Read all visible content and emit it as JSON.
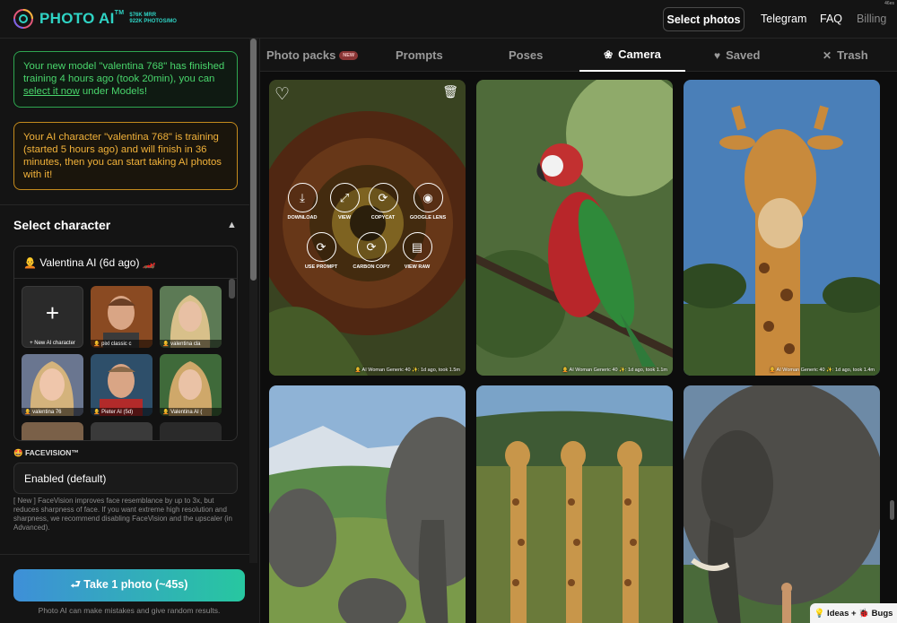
{
  "header": {
    "logo_name": "PHOTO AI",
    "logo_tm": "TM",
    "stats_line1": "$76K MRR",
    "stats_line2": "922K PHOTOS/MO",
    "select_photos": "Select photos",
    "nav": [
      "Telegram",
      "FAQ",
      "Billing"
    ],
    "corner": "46es"
  },
  "sidebar": {
    "notice_ready_pre": "Your new model \"valentina 768\" has finished training 4 hours ago (took 20min), you can ",
    "notice_ready_link": "select it now",
    "notice_ready_post": " under Models!",
    "notice_training": "Your AI character \"valentina 768\" is training (started 5 hours ago) and will finish in 36 minutes, then you can start taking AI photos with it!",
    "select_character": "Select character",
    "character_name": "🧑‍🦲 Valentina AI (6d ago) 🏎️",
    "new_character": "+ New AI character",
    "tiles": [
      {
        "caption": "🧑‍🦲 pixl classic c"
      },
      {
        "caption": "🧑‍🦲 valentina cla"
      },
      {
        "caption": "🧑‍🦲 valentina 76"
      },
      {
        "caption": "🧑‍🦲 Pieter AI (5d)"
      },
      {
        "caption": "🧑‍🦲 Valentina AI ("
      }
    ],
    "facevision_label": "🤩 FACEVISION™",
    "facevision_value": "Enabled (default)",
    "facevision_note": "[ New ] FaceVision improves face resemblance by up to 3x, but reduces sharpness of face. If you want extreme high resolution and sharpness, we recommend disabling FaceVision and the upscaler (in Advanced).",
    "take_photo": "⮐ Take 1 photo (~45s)",
    "disclaimer": "Photo AI can make mistakes and give random results."
  },
  "tabs": {
    "packs": "Photo packs",
    "packs_badge": "NEW",
    "prompts": "Prompts",
    "poses": "Poses",
    "camera": "Camera",
    "saved": "Saved",
    "trash": "Trash"
  },
  "gallery": {
    "actions": [
      "DOWNLOAD",
      "VIEW",
      "COPYCAT",
      "GOOGLE LENS",
      "USE PROMPT",
      "CARBON COPY",
      "VIEW RAW"
    ],
    "photos": [
      {
        "meta": "🧑‍🦲 AI Woman Generic 40 ✨: 1d ago, took 1.5m"
      },
      {
        "meta": "🧑‍🦲 AI Woman Generic 40 ✨: 1d ago, took 1.1m"
      },
      {
        "meta": "🧑‍🦲 AI Woman Generic 40 ✨: 1d ago, took 1.4m"
      },
      {
        "meta": ""
      },
      {
        "meta": ""
      },
      {
        "meta": ""
      }
    ]
  },
  "ideas_button": "💡 Ideas + 🐞 Bugs",
  "colors": {
    "accent": "#2fd3c4",
    "ready": "#49d66c",
    "training": "#f2b23a",
    "cta_start": "#3e8fd8",
    "cta_end": "#27c7a0"
  }
}
